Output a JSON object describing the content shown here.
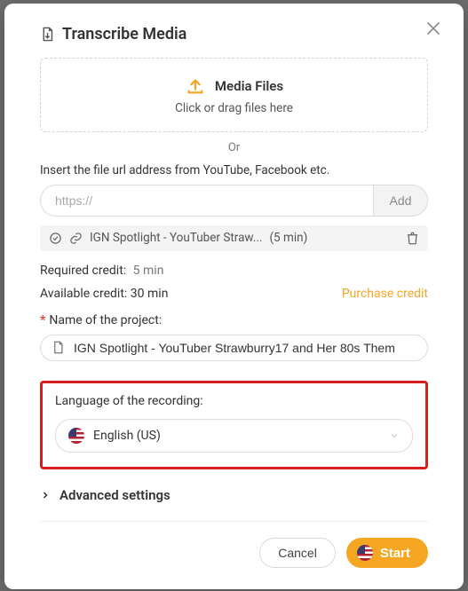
{
  "title": "Transcribe Media",
  "dropzone": {
    "title": "Media Files",
    "subtitle": "Click or drag files here"
  },
  "orLabel": "Or",
  "urlSection": {
    "label": "Insert the file url address from YouTube, Facebook etc.",
    "placeholder": "https://",
    "addLabel": "Add"
  },
  "queuedItem": {
    "name": "IGN Spotlight - YouTuber Straw...",
    "duration": "(5 min)"
  },
  "requiredCredit": {
    "label": "Required credit:",
    "value": "5 min"
  },
  "availableCredit": {
    "label": "Available credit:",
    "value": "30 min"
  },
  "purchaseLabel": "Purchase credit",
  "projectName": {
    "label": "Name of the project:",
    "value": "IGN Spotlight - YouTuber Strawburry17 and Her 80s Them"
  },
  "language": {
    "label": "Language of the recording:",
    "selected": "English (US)"
  },
  "advancedLabel": "Advanced settings",
  "buttons": {
    "cancel": "Cancel",
    "start": "Start"
  },
  "colors": {
    "accent": "#f5a623",
    "danger": "#d61f1f"
  }
}
